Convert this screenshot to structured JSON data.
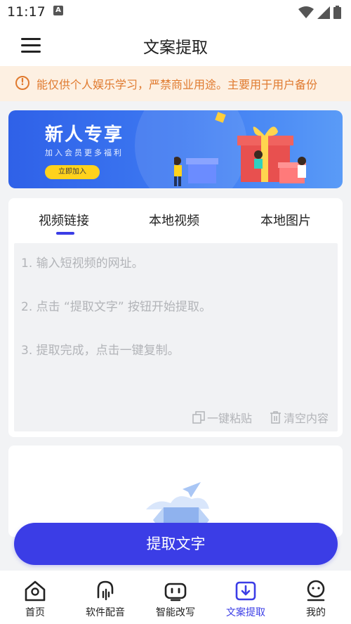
{
  "status_bar": {
    "time": "11:17",
    "notification_glyph": "A",
    "icons": [
      "wifi-icon",
      "signal-icon",
      "battery-icon"
    ]
  },
  "app_bar": {
    "title": "文案提取",
    "menu_icon": "menu-icon"
  },
  "notice": {
    "text": "能仅供个人娱乐学习，严禁商业用途。主要用于用户备份",
    "icon": "alert-circle-icon",
    "color": "#e07a2f"
  },
  "banner": {
    "title": "新人专享",
    "subtitle": "加入会员更多福利",
    "button_label": "立即加入"
  },
  "tabs": [
    {
      "label": "视频链接",
      "active": true
    },
    {
      "label": "本地视频",
      "active": false
    },
    {
      "label": "本地图片",
      "active": false
    }
  ],
  "input": {
    "placeholder_lines": [
      "1. 输入短视频的网址。",
      "2. 点击 “提取文字” 按钮开始提取。",
      "3. 提取完成，点击一键复制。"
    ],
    "paste_label": "一键粘贴",
    "clear_label": "清空内容"
  },
  "primary_button": {
    "label": "提取文字"
  },
  "bottom_nav": [
    {
      "label": "首页",
      "icon": "home-icon",
      "active": false
    },
    {
      "label": "软件配音",
      "icon": "voice-icon",
      "active": false
    },
    {
      "label": "智能改写",
      "icon": "robot-icon",
      "active": false
    },
    {
      "label": "文案提取",
      "icon": "extract-icon",
      "active": true
    },
    {
      "label": "我的",
      "icon": "profile-icon",
      "active": false
    }
  ],
  "colors": {
    "accent": "#3b3de6",
    "notice_bg": "#fdf0e2",
    "banner_blue": "#2f61e8",
    "banner_button": "#ffd21c"
  }
}
